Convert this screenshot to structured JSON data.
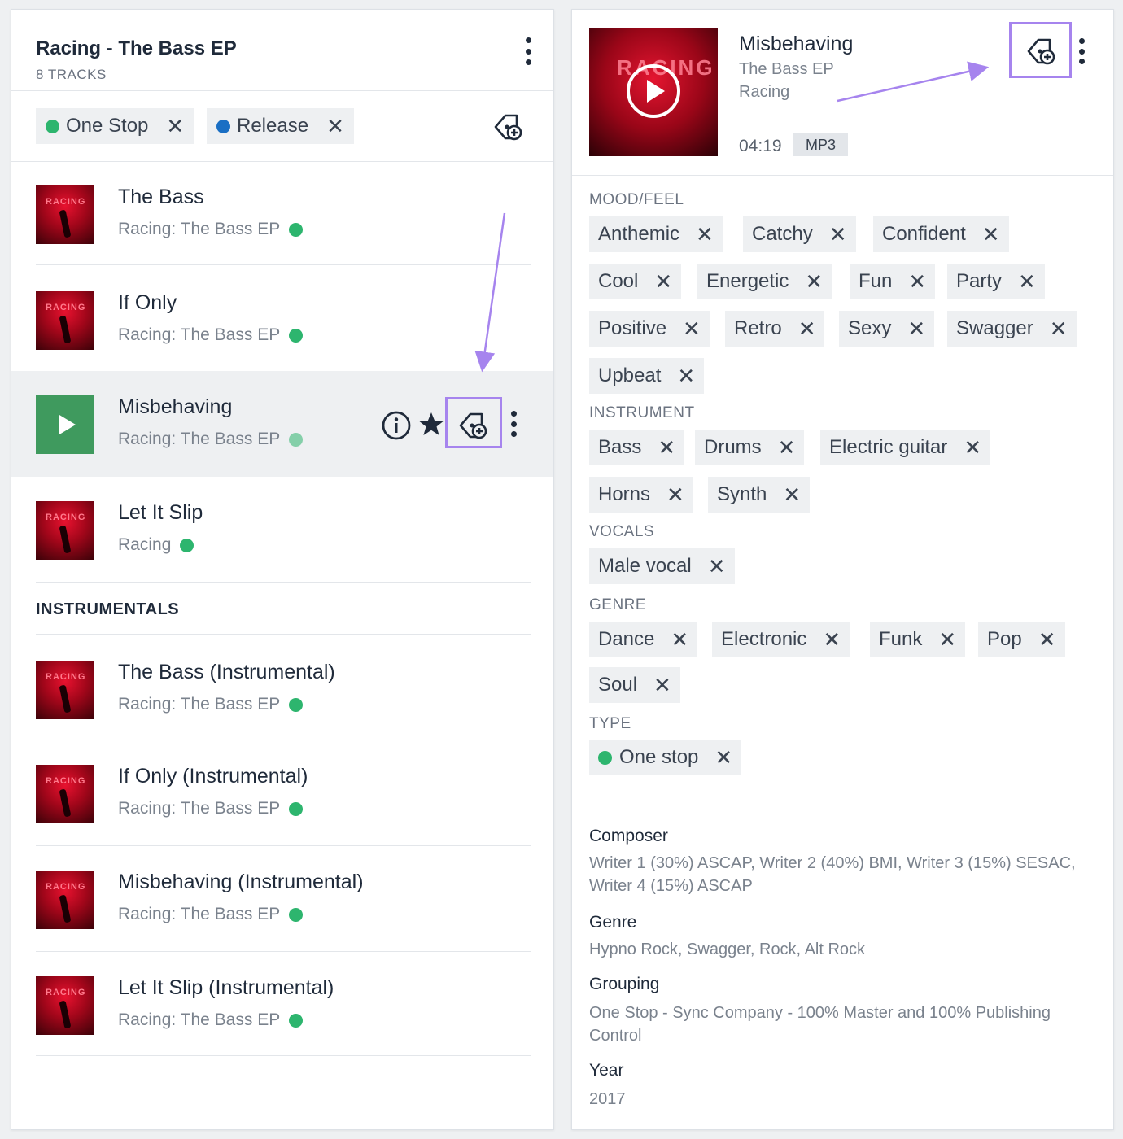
{
  "playlist": {
    "title": "Racing - The Bass EP",
    "track_count": "8 TRACKS"
  },
  "filters": [
    {
      "label": "One Stop",
      "color": "#2db56e"
    },
    {
      "label": "Release",
      "color": "#1a6fc4"
    }
  ],
  "tracks": [
    {
      "title": "The Bass",
      "subtitle": "Racing: The Bass EP",
      "art_text": "RACING"
    },
    {
      "title": "If Only",
      "subtitle": "Racing: The Bass EP",
      "art_text": "RACING"
    },
    {
      "title": "Misbehaving",
      "subtitle": "Racing: The Bass EP",
      "art_text": "RACING"
    },
    {
      "title": "Let It Slip",
      "subtitle": "Racing",
      "art_text": "RACING"
    }
  ],
  "instrumentals_label": "INSTRUMENTALS",
  "instrumentals": [
    {
      "title": "The Bass (Instrumental)",
      "subtitle": "Racing: The Bass EP",
      "art_text": "RACING"
    },
    {
      "title": "If Only (Instrumental)",
      "subtitle": "Racing: The Bass EP",
      "art_text": "RACING"
    },
    {
      "title": "Misbehaving (Instrumental)",
      "subtitle": "Racing: The Bass EP",
      "art_text": "RACING"
    },
    {
      "title": "Let It Slip (Instrumental)",
      "subtitle": "Racing: The Bass EP",
      "art_text": "RACING"
    }
  ],
  "detail": {
    "cover_text": "RACING",
    "title": "Misbehaving",
    "album": "The Bass EP",
    "artist": "Racing",
    "duration": "04:19",
    "format": "MP3"
  },
  "tag_groups": [
    {
      "label": "MOOD/FEEL",
      "tags": [
        "Anthemic",
        "Catchy",
        "Confident",
        "Cool",
        "Energetic",
        "Fun",
        "Party",
        "Positive",
        "Retro",
        "Sexy",
        "Swagger",
        "Upbeat"
      ]
    },
    {
      "label": "INSTRUMENT",
      "tags": [
        "Bass",
        "Drums",
        "Electric guitar",
        "Horns",
        "Synth"
      ]
    },
    {
      "label": "VOCALS",
      "tags": [
        "Male vocal"
      ]
    },
    {
      "label": "GENRE",
      "tags": [
        "Dance",
        "Electronic",
        "Funk",
        "Pop",
        "Soul"
      ]
    },
    {
      "label": "TYPE",
      "tags": [
        "One stop"
      ]
    }
  ],
  "metadata": [
    {
      "label": "Composer",
      "value": "Writer 1 (30%) ASCAP, Writer 2 (40%) BMI, Writer 3 (15%) SESAC, Writer 4 (15%) ASCAP"
    },
    {
      "label": "Genre",
      "value": "Hypno Rock, Swagger, Rock, Alt Rock"
    },
    {
      "label": "Grouping",
      "value": "One Stop - Sync Company - 100% Master and 100% Publishing Control"
    },
    {
      "label": "Year",
      "value": "2017"
    }
  ],
  "colors": {
    "status_green": "#2db56e",
    "release_blue": "#1a6fc4",
    "highlight_purple": "#a684ee",
    "play_green": "#3f9a5e"
  }
}
